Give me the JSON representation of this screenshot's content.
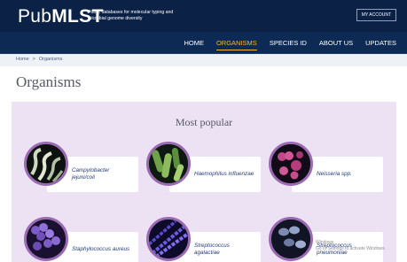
{
  "brand": {
    "logo_light": "Pub",
    "logo_bold": "MLST",
    "tagline": "Public databases for molecular typing and microbial genome diversity",
    "account_label": "MY ACCOUNT"
  },
  "nav": {
    "items": [
      {
        "label": "HOME",
        "active": false
      },
      {
        "label": "ORGANISMS",
        "active": true
      },
      {
        "label": "SPECIES ID",
        "active": false
      },
      {
        "label": "ABOUT US",
        "active": false
      },
      {
        "label": "UPDATES",
        "active": false
      }
    ]
  },
  "breadcrumb": {
    "home": "Home",
    "separator": ">",
    "current": "Organisms"
  },
  "page": {
    "title": "Organisms"
  },
  "popular": {
    "title": "Most popular",
    "items": [
      {
        "name": "Campylobacter jejuni/coli"
      },
      {
        "name": "Haemophilus influenzae"
      },
      {
        "name": "Neisseria spp."
      },
      {
        "name": "Staphylococcus aureus"
      },
      {
        "name": "Streptococcus agalactiae"
      },
      {
        "name": "Streptococcus pneumoniae"
      }
    ]
  },
  "watermark": {
    "line1": "Windows",
    "line2": "Go to Settings to activate Windows."
  },
  "colors": {
    "header_bg": "#0b2146",
    "nav_bg": "#0d2a55",
    "nav_active": "#f2b43a",
    "panel_bg": "#ede2f3",
    "thumb_ring": "#9a6ab3",
    "organism_link": "#223b7a"
  }
}
